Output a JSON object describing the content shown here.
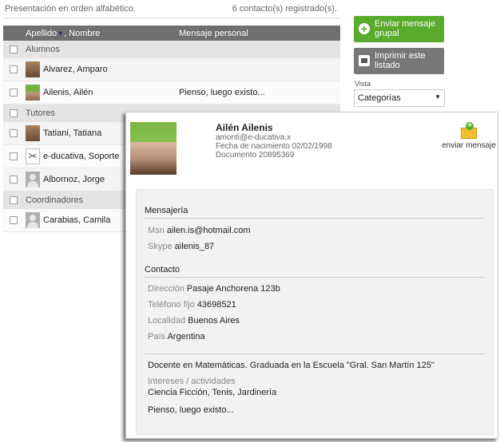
{
  "top": {
    "presentation": "Presentación en orden alfabético.",
    "count": "6 contacto(s) registrado(s)."
  },
  "table": {
    "col_name": "Apellido",
    "col_name2": ", Nombre",
    "sort_icon": "▼",
    "col_msg": "Mensaje personal",
    "groups": {
      "alumnos": "Alumnos",
      "tutores": "Tutores",
      "coordinadores": "Coordinadores"
    },
    "rows": {
      "r1": {
        "name": "Alvarez, Amparo",
        "msg": ""
      },
      "r2": {
        "name": "Ailenis, Ailén",
        "msg": "Pienso, luego existo..."
      },
      "r3": {
        "name": "Tatiani, Tatiana",
        "msg": ""
      },
      "r4": {
        "name": "e-ducativa, Soporte",
        "msg": ""
      },
      "r5": {
        "name": "Albornoz, Jorge",
        "msg": ""
      },
      "r6": {
        "name": "Carabias, Camila",
        "msg": ""
      }
    }
  },
  "actions": {
    "group_msg": "Enviar mensaje grupal",
    "print": "Imprimir este listado",
    "vista_label": "Vista",
    "vista_value": "Categorías"
  },
  "profile": {
    "name": "Ailén Ailenis",
    "email": "amonti@e-ducativa.x",
    "birth": "Fecha de nacimiento 02/02/1998",
    "doc": "Documento 20895369",
    "send_label": "enviar mensaje",
    "mensajeria": "Mensajería",
    "msn_k": "Msn",
    "msn_v": "ailen.is@hotmail.com",
    "skype_k": "Skype",
    "skype_v": "ailenis_87",
    "contacto": "Contacto",
    "dir_k": "Dirección",
    "dir_v": "Pasaje Anchorena 123b",
    "tel_k": "Teléfono fijo",
    "tel_v": "43698521",
    "loc_k": "Localidad",
    "loc_v": "Buenos Aires",
    "pais_k": "País",
    "pais_v": "Argentina",
    "bio": "Docente en Matemáticas. Graduada en la Escuela \"Gral. San Martín 125\"",
    "int_k": "Intereses / actividades",
    "int_v": "Ciencia Ficción, Tenis, Jardinería",
    "quote": "Pienso, luego existo..."
  }
}
